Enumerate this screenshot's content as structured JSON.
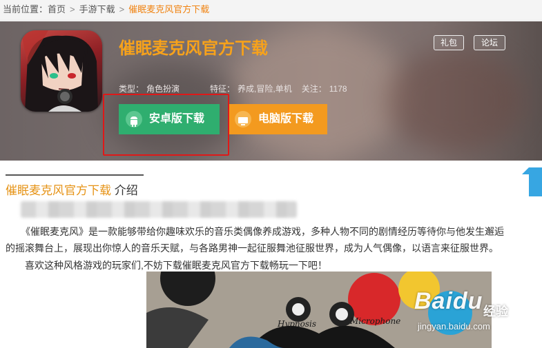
{
  "breadcrumb": {
    "prefix": "当前位置：",
    "home": "首页",
    "sep": ">",
    "category": "手游下载",
    "current": "催眠麦克风官方下载"
  },
  "game": {
    "title": "催眠麦克风官方下载",
    "type_label": "类型：",
    "type_value": "角色扮演",
    "feature_label": "特征：",
    "feature_value": "养成,冒险,单机",
    "follow_label": "关注：",
    "follow_value": "1178",
    "icon_name": "game-character-portrait"
  },
  "tags": {
    "gift": "礼包",
    "forum": "论坛"
  },
  "download": {
    "android_label": "安卓版下载",
    "android_icon": "android-icon",
    "pc_label": "电脑版下载",
    "pc_icon": "monitor-icon",
    "android_color": "#2fae6f",
    "pc_color": "#f39a1f"
  },
  "intro": {
    "title_game": "催眠麦克风官方下载",
    "title_suffix": "介绍",
    "para1": "《催眠麦克风》是一款能够带给你趣味欢乐的音乐类偶像养成游戏，多种人物不同的剧情经历等待你与他发生邂逅",
    "para2": "的摇滚舞台上，展现出你惊人的音乐天赋，与各路男神一起征服舞池征服世界，成为人气偶像，以语言来征服世界。",
    "para3": "喜欢这种风格游戏的玩家们,不妨下载催眠麦克风官方下载畅玩一下吧！"
  },
  "artwork": {
    "logo_left": "Hypnosis",
    "logo_right": "Microphone"
  },
  "watermark": {
    "logo": "Baidu",
    "cn": "经验",
    "url": "jingyan.baidu.com"
  },
  "colors": {
    "accent_orange": "#f7a21b",
    "highlight_red": "#e01818",
    "side_tab_blue": "#37a6e2"
  }
}
